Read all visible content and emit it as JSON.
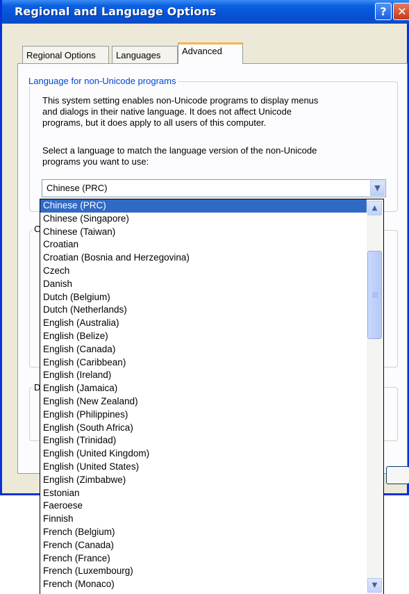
{
  "window": {
    "title": "Regional and Language Options",
    "help_glyph": "?",
    "close_glyph": "✕"
  },
  "tabs": [
    {
      "label": "Regional Options",
      "active": false
    },
    {
      "label": "Languages",
      "active": false
    },
    {
      "label": "Advanced",
      "active": true
    }
  ],
  "non_unicode_group": {
    "legend": "Language for non-Unicode programs",
    "description_lines": [
      "This system setting enables non-Unicode programs to display menus",
      "and dialogs in their native language. It does not affect Unicode",
      "programs, but it does apply to all users of this computer."
    ],
    "instruction_lines": [
      "Select a language to match the language version of the non-Unicode",
      "programs you want to use:"
    ],
    "selected_language": "Chinese (PRC)"
  },
  "hidden_group_fragments": [
    "C",
    "D"
  ],
  "language_options": [
    "Chinese (PRC)",
    "Chinese (Singapore)",
    "Chinese (Taiwan)",
    "Croatian",
    "Croatian (Bosnia and Herzegovina)",
    "Czech",
    "Danish",
    "Dutch (Belgium)",
    "Dutch (Netherlands)",
    "English (Australia)",
    "English (Belize)",
    "English (Canada)",
    "English (Caribbean)",
    "English (Ireland)",
    "English (Jamaica)",
    "English (New Zealand)",
    "English (Philippines)",
    "English (South Africa)",
    "English (Trinidad)",
    "English (United Kingdom)",
    "English (United States)",
    "English (Zimbabwe)",
    "Estonian",
    "Faeroese",
    "Finnish",
    "French (Belgium)",
    "French (Canada)",
    "French (France)",
    "French (Luxembourg)",
    "French (Monaco)"
  ],
  "icons": {
    "combo_arrow": "chevron-down-icon",
    "scroll_up": "chevron-up-icon",
    "scroll_down": "chevron-down-icon"
  },
  "colors": {
    "titlebar": "#0a5fe0",
    "selection": "#316ac5",
    "group_legend": "#0046d5",
    "active_tab_accent": "#f7b54a"
  }
}
